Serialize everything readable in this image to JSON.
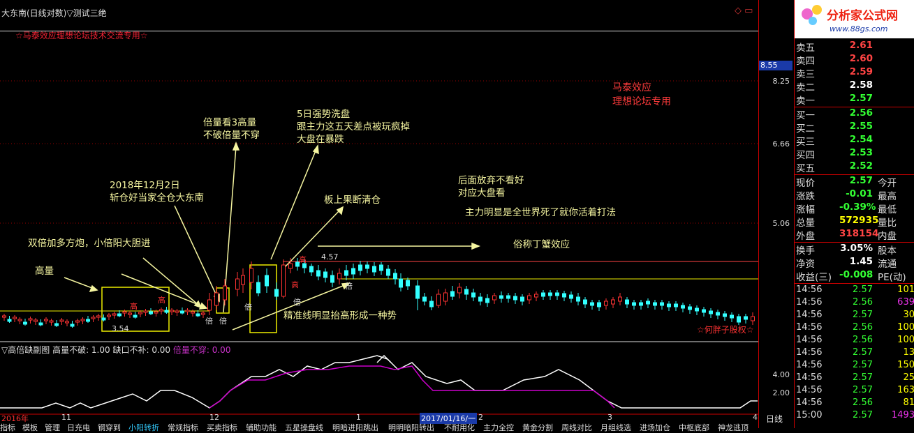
{
  "title": "大东南(日线对数)▽测试三绝",
  "watermark": "☆马泰效应理想论坛技术交流专用☆",
  "top_icons": "◇ ▭",
  "annotations": {
    "gaoliang": "高量",
    "shuangbei": "双倍加多方炮，小倍阳大胆进",
    "date_note": "2018年12月2日\n斩仓好当家全仓大东南",
    "beiliang": "倍量看3高量\n不破倍量不穿",
    "wuri": "5日强势洗盘\n跟主力这五天差点被玩疯掉\n大盘在暴跌",
    "banshang": "板上果断清仓",
    "houmian": "后面放弃不看好\n对应大盘看",
    "zhuli": "主力明显是全世界死了就你活着打法",
    "suchen": "俗称丁蟹效应",
    "jingzhun": "精准线明显抬高形成一种势",
    "mataired": "马泰效应\n理想论坛专用",
    "hepangzi": "☆何胖子股权☆"
  },
  "chart_marks": {
    "gao": "高",
    "bei": "倍",
    "low_price": "3.54",
    "high_price": "4.57"
  },
  "price_axis": {
    "current": "8.55",
    "ticks": [
      "8.25",
      "6.66",
      "5.06"
    ]
  },
  "sub_chart": {
    "title_prefix": "▽高倍缺副图",
    "f1": "高量不破: 1.00",
    "f2": "缺口不补: 0.00",
    "f3": "倍量不穿: 0.00",
    "ticks": [
      "4.00",
      "2.00"
    ]
  },
  "date_axis": {
    "labels": [
      "2016年",
      "11",
      "12",
      "1",
      "2017/01/16/一",
      "2",
      "3",
      "4"
    ],
    "period": "日线"
  },
  "bottom_tabs": [
    "指标",
    "模板",
    "管理",
    "日充电",
    "钢穿到",
    "小阳转折",
    "常规指标",
    "买卖指标",
    "辅助功能",
    "五星操盘线",
    "明暗进阳跳出",
    "明明暗阳转出",
    "不耐用化",
    "主力全控",
    "黄金分割",
    "周线对比",
    "月组线选",
    "进场加仓",
    "中枢底部",
    "神龙逃顶"
  ],
  "quote": {
    "asks": [
      {
        "label": "卖五",
        "price": "2.61"
      },
      {
        "label": "卖四",
        "price": "2.60"
      },
      {
        "label": "卖三",
        "price": "2.59"
      },
      {
        "label": "卖二",
        "price": "2.58"
      },
      {
        "label": "卖一",
        "price": "2.57"
      }
    ],
    "bids": [
      {
        "label": "买一",
        "price": "2.56"
      },
      {
        "label": "买二",
        "price": "2.55"
      },
      {
        "label": "买三",
        "price": "2.54"
      },
      {
        "label": "买四",
        "price": "2.53"
      },
      {
        "label": "买五",
        "price": "2.52"
      }
    ],
    "stats1": [
      {
        "label": "现价",
        "value": "2.57",
        "label2": "今开"
      },
      {
        "label": "涨跌",
        "value": "-0.01",
        "label2": "最高"
      },
      {
        "label": "涨幅",
        "value": "-0.39%",
        "label2": "最低"
      },
      {
        "label": "总量",
        "value": "572935",
        "label2": "量比"
      },
      {
        "label": "外盘",
        "value": "318154",
        "label2": "内盘"
      }
    ],
    "stats2": [
      {
        "label": "换手",
        "value": "3.05%",
        "label2": "股本"
      },
      {
        "label": "净资",
        "value": "1.45",
        "label2": "流通"
      },
      {
        "label": "收益(三)",
        "value": "-0.008",
        "label2": "PE(动)"
      }
    ],
    "ticks": [
      {
        "time": "14:56",
        "price": "2.57",
        "vol": "101"
      },
      {
        "time": "14:56",
        "price": "2.56",
        "vol": "639"
      },
      {
        "time": "14:56",
        "price": "2.57",
        "vol": "30"
      },
      {
        "time": "14:56",
        "price": "2.56",
        "vol": "100"
      },
      {
        "time": "14:56",
        "price": "2.56",
        "vol": "100"
      },
      {
        "time": "14:56",
        "price": "2.57",
        "vol": "13"
      },
      {
        "time": "14:56",
        "price": "2.57",
        "vol": "150"
      },
      {
        "time": "14:56",
        "price": "2.57",
        "vol": "25"
      },
      {
        "time": "14:56",
        "price": "2.57",
        "vol": "163"
      },
      {
        "time": "14:56",
        "price": "2.56",
        "vol": "81"
      },
      {
        "time": "15:00",
        "price": "2.57",
        "vol": "1493"
      }
    ]
  },
  "logo": {
    "name": "分析家公式网",
    "url": "www.88gs.com"
  },
  "colors": {
    "up": "#ff3333",
    "down": "#33ffff",
    "annotation": "#f5f5a0",
    "grid": "#cc0000"
  }
}
